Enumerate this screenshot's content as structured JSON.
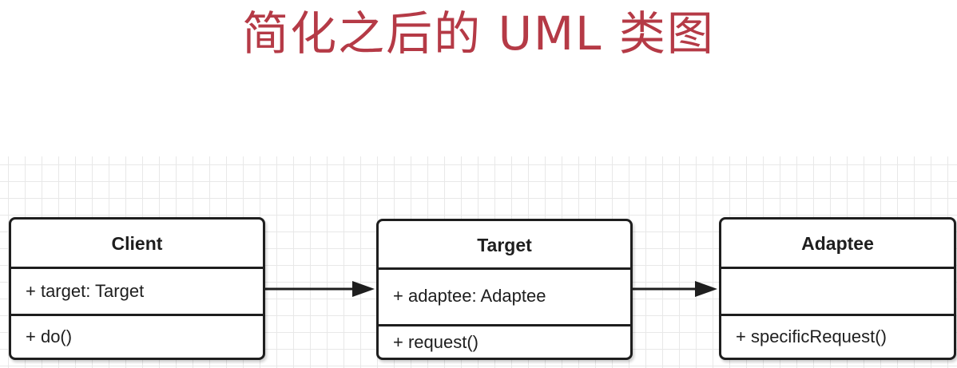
{
  "title": "简化之后的 UML 类图",
  "colors": {
    "title": "#b53a46",
    "stroke": "#1e1e1e",
    "grid": "#e8e8e8"
  },
  "classes": {
    "client": {
      "name": "Client",
      "attribute": "+ target: Target",
      "operation": "+ do()"
    },
    "target": {
      "name": "Target",
      "attribute": "+ adaptee: Adaptee",
      "operation": "+ request()"
    },
    "adaptee": {
      "name": "Adaptee",
      "attribute": "",
      "operation": "+ specificRequest()"
    }
  },
  "associations": [
    {
      "from": "Client",
      "to": "Target",
      "arrow": "filled-triangle"
    },
    {
      "from": "Target",
      "to": "Adaptee",
      "arrow": "filled-triangle"
    }
  ]
}
